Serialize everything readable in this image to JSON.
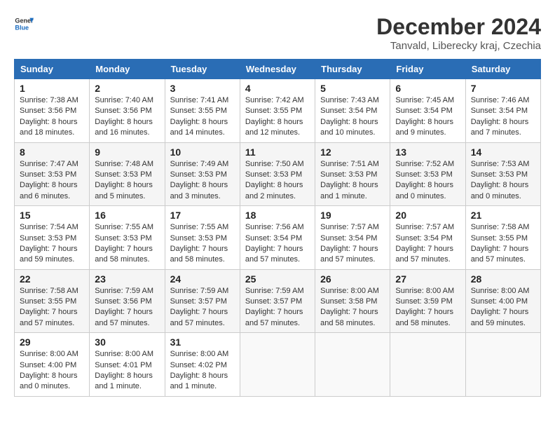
{
  "header": {
    "logo_line1": "General",
    "logo_line2": "Blue",
    "month": "December 2024",
    "location": "Tanvald, Liberecky kraj, Czechia"
  },
  "days_of_week": [
    "Sunday",
    "Monday",
    "Tuesday",
    "Wednesday",
    "Thursday",
    "Friday",
    "Saturday"
  ],
  "weeks": [
    [
      {
        "day": "1",
        "sunrise": "7:38 AM",
        "sunset": "3:56 PM",
        "daylight": "8 hours and 18 minutes."
      },
      {
        "day": "2",
        "sunrise": "7:40 AM",
        "sunset": "3:56 PM",
        "daylight": "8 hours and 16 minutes."
      },
      {
        "day": "3",
        "sunrise": "7:41 AM",
        "sunset": "3:55 PM",
        "daylight": "8 hours and 14 minutes."
      },
      {
        "day": "4",
        "sunrise": "7:42 AM",
        "sunset": "3:55 PM",
        "daylight": "8 hours and 12 minutes."
      },
      {
        "day": "5",
        "sunrise": "7:43 AM",
        "sunset": "3:54 PM",
        "daylight": "8 hours and 10 minutes."
      },
      {
        "day": "6",
        "sunrise": "7:45 AM",
        "sunset": "3:54 PM",
        "daylight": "8 hours and 9 minutes."
      },
      {
        "day": "7",
        "sunrise": "7:46 AM",
        "sunset": "3:54 PM",
        "daylight": "8 hours and 7 minutes."
      }
    ],
    [
      {
        "day": "8",
        "sunrise": "7:47 AM",
        "sunset": "3:53 PM",
        "daylight": "8 hours and 6 minutes."
      },
      {
        "day": "9",
        "sunrise": "7:48 AM",
        "sunset": "3:53 PM",
        "daylight": "8 hours and 5 minutes."
      },
      {
        "day": "10",
        "sunrise": "7:49 AM",
        "sunset": "3:53 PM",
        "daylight": "8 hours and 3 minutes."
      },
      {
        "day": "11",
        "sunrise": "7:50 AM",
        "sunset": "3:53 PM",
        "daylight": "8 hours and 2 minutes."
      },
      {
        "day": "12",
        "sunrise": "7:51 AM",
        "sunset": "3:53 PM",
        "daylight": "8 hours and 1 minute."
      },
      {
        "day": "13",
        "sunrise": "7:52 AM",
        "sunset": "3:53 PM",
        "daylight": "8 hours and 0 minutes."
      },
      {
        "day": "14",
        "sunrise": "7:53 AM",
        "sunset": "3:53 PM",
        "daylight": "8 hours and 0 minutes."
      }
    ],
    [
      {
        "day": "15",
        "sunrise": "7:54 AM",
        "sunset": "3:53 PM",
        "daylight": "7 hours and 59 minutes."
      },
      {
        "day": "16",
        "sunrise": "7:55 AM",
        "sunset": "3:53 PM",
        "daylight": "7 hours and 58 minutes."
      },
      {
        "day": "17",
        "sunrise": "7:55 AM",
        "sunset": "3:53 PM",
        "daylight": "7 hours and 58 minutes."
      },
      {
        "day": "18",
        "sunrise": "7:56 AM",
        "sunset": "3:54 PM",
        "daylight": "7 hours and 57 minutes."
      },
      {
        "day": "19",
        "sunrise": "7:57 AM",
        "sunset": "3:54 PM",
        "daylight": "7 hours and 57 minutes."
      },
      {
        "day": "20",
        "sunrise": "7:57 AM",
        "sunset": "3:54 PM",
        "daylight": "7 hours and 57 minutes."
      },
      {
        "day": "21",
        "sunrise": "7:58 AM",
        "sunset": "3:55 PM",
        "daylight": "7 hours and 57 minutes."
      }
    ],
    [
      {
        "day": "22",
        "sunrise": "7:58 AM",
        "sunset": "3:55 PM",
        "daylight": "7 hours and 57 minutes."
      },
      {
        "day": "23",
        "sunrise": "7:59 AM",
        "sunset": "3:56 PM",
        "daylight": "7 hours and 57 minutes."
      },
      {
        "day": "24",
        "sunrise": "7:59 AM",
        "sunset": "3:57 PM",
        "daylight": "7 hours and 57 minutes."
      },
      {
        "day": "25",
        "sunrise": "7:59 AM",
        "sunset": "3:57 PM",
        "daylight": "7 hours and 57 minutes."
      },
      {
        "day": "26",
        "sunrise": "8:00 AM",
        "sunset": "3:58 PM",
        "daylight": "7 hours and 58 minutes."
      },
      {
        "day": "27",
        "sunrise": "8:00 AM",
        "sunset": "3:59 PM",
        "daylight": "7 hours and 58 minutes."
      },
      {
        "day": "28",
        "sunrise": "8:00 AM",
        "sunset": "4:00 PM",
        "daylight": "7 hours and 59 minutes."
      }
    ],
    [
      {
        "day": "29",
        "sunrise": "8:00 AM",
        "sunset": "4:00 PM",
        "daylight": "8 hours and 0 minutes."
      },
      {
        "day": "30",
        "sunrise": "8:00 AM",
        "sunset": "4:01 PM",
        "daylight": "8 hours and 1 minute."
      },
      {
        "day": "31",
        "sunrise": "8:00 AM",
        "sunset": "4:02 PM",
        "daylight": "8 hours and 1 minute."
      },
      null,
      null,
      null,
      null
    ]
  ]
}
